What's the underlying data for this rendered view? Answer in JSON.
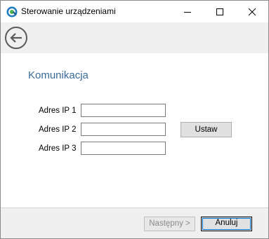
{
  "window": {
    "title": "Sterowanie urządzeniami"
  },
  "page": {
    "title": "Komunikacja"
  },
  "fields": [
    {
      "label": "Adres IP 1",
      "value": ""
    },
    {
      "label": "Adres IP 2",
      "value": ""
    },
    {
      "label": "Adres IP 3",
      "value": ""
    }
  ],
  "buttons": {
    "set": "Ustaw",
    "next": "Następny >",
    "cancel": "Anuluj"
  },
  "icons": {
    "app": "device-control-icon",
    "back": "back-arrow-icon",
    "minimize": "minimize-icon",
    "maximize": "maximize-icon",
    "close": "close-icon"
  },
  "colors": {
    "accent": "#3a6a9a",
    "focus": "#0078d7",
    "disabled_text": "#8a8a8a"
  }
}
